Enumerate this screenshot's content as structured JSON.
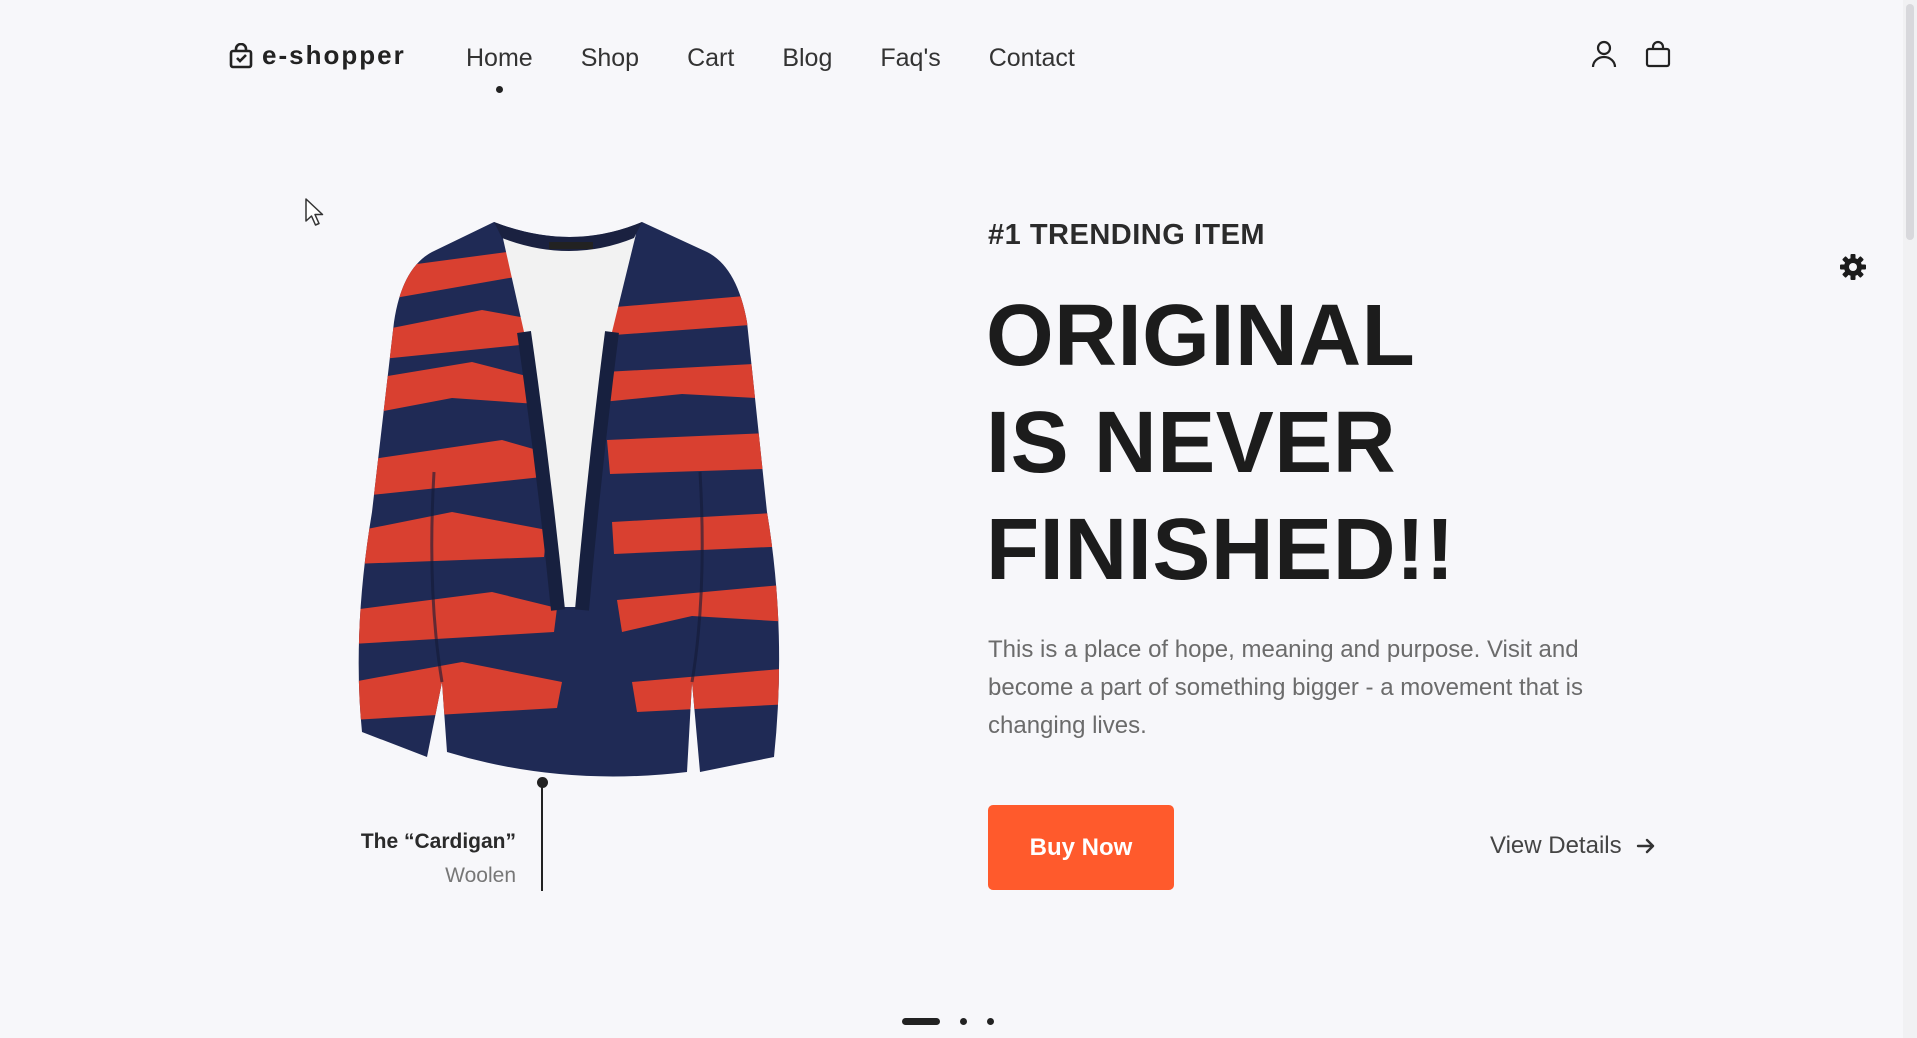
{
  "brand": {
    "name": "e-shopper",
    "icon": "shopping-bag-icon"
  },
  "nav": {
    "items": [
      {
        "label": "Home",
        "active": true
      },
      {
        "label": "Shop",
        "active": false
      },
      {
        "label": "Cart",
        "active": false
      },
      {
        "label": "Blog",
        "active": false
      },
      {
        "label": "Faq's",
        "active": false
      },
      {
        "label": "Contact",
        "active": false
      }
    ]
  },
  "header_icons": [
    "user-icon",
    "cart-bag-icon"
  ],
  "hero": {
    "eyebrow": "#1 TRENDING ITEM",
    "headline_lines": [
      "ORIGINAL",
      "IS NEVER",
      "FINISHED!!"
    ],
    "description": "This is a place of hope, meaning and purpose. Visit and become a part of something bigger - a movement that is changing lives.",
    "buy_label": "Buy Now",
    "details_label": "View Details"
  },
  "product": {
    "name": "The “Cardigan”",
    "material": "Woolen"
  },
  "carousel": {
    "slide_count": 3,
    "active_index": 0
  },
  "colors": {
    "accent": "#ff5a2c",
    "background": "#f7f7fa",
    "text_dark": "#1c1c1c",
    "text_muted": "#6b6b6b",
    "cardigan_navy": "#1f2a55",
    "cardigan_red": "#d94030"
  }
}
